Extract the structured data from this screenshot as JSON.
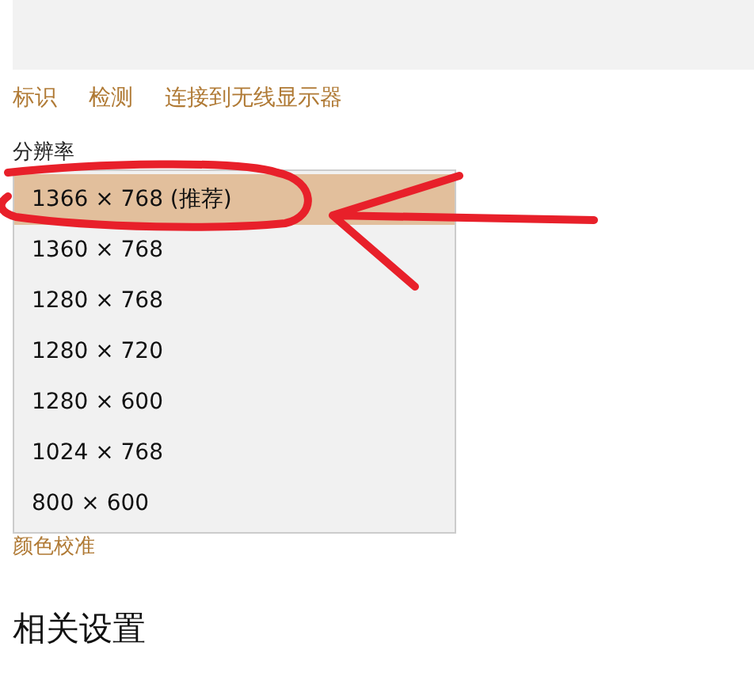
{
  "links": [
    "标识",
    "检测",
    "连接到无线显示器"
  ],
  "resolution": {
    "label": "分辨率",
    "options": [
      {
        "label": "1366 × 768 (推荐)",
        "selected": true
      },
      {
        "label": "1360 × 768",
        "selected": false
      },
      {
        "label": "1280 × 768",
        "selected": false
      },
      {
        "label": "1280 × 720",
        "selected": false
      },
      {
        "label": "1280 × 600",
        "selected": false
      },
      {
        "label": "1024 × 768",
        "selected": false
      },
      {
        "label": "800 × 600",
        "selected": false
      }
    ]
  },
  "color_link": "颜色校准",
  "related_heading": "相关设置"
}
